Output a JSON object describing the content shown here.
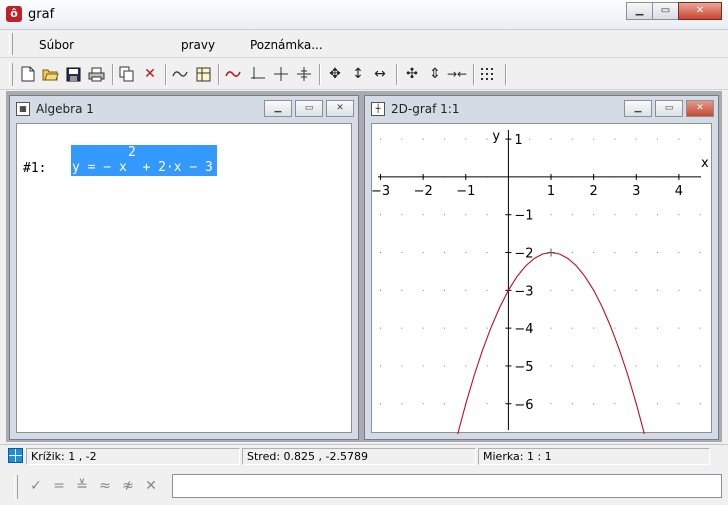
{
  "window": {
    "title": "graf"
  },
  "menu": {
    "items": [
      "Súbor",
      "pravy",
      "Poznámka..."
    ]
  },
  "toolbar": {
    "buttons": [
      "new-file",
      "open-folder",
      "save",
      "print",
      "copy",
      "delete",
      "function",
      "abc-table",
      "curve",
      "axis",
      "cross",
      "cross-hash",
      "move-all",
      "move-vertical",
      "move-horizontal",
      "zoom-in-all",
      "zoom-vertical",
      "zoom-horizontal",
      "grid-dots"
    ]
  },
  "algebra_window": {
    "title": "Algebra 1",
    "expression": {
      "label": "#1:",
      "exponent": "2",
      "body": "y = − x  + 2·x − 3"
    }
  },
  "graph_window": {
    "title": "2D-graf 1:1",
    "x_axis_label": "x",
    "y_axis_label": "y",
    "x_ticks": [
      "−3",
      "−2",
      "−1",
      "1",
      "2",
      "3",
      "4"
    ],
    "y_ticks": [
      "1",
      "−1",
      "−2",
      "−3",
      "−4",
      "−5",
      "−6"
    ]
  },
  "chart_data": {
    "type": "line",
    "function": "y = -x^2 + 2x - 3",
    "x": [
      -1.2,
      -1.0,
      -0.8,
      -0.6,
      -0.4,
      -0.2,
      0.0,
      0.2,
      0.4,
      0.6,
      0.8,
      1.0,
      1.2,
      1.4,
      1.6,
      1.8,
      2.0,
      2.2,
      2.4,
      2.6,
      2.8,
      3.0,
      3.2
    ],
    "y": [
      -6.84,
      -6.0,
      -5.24,
      -4.56,
      -3.96,
      -3.44,
      -3.0,
      -2.64,
      -2.36,
      -2.16,
      -2.04,
      -2.0,
      -2.04,
      -2.16,
      -2.36,
      -2.64,
      -3.0,
      -3.44,
      -3.96,
      -4.56,
      -5.24,
      -6.0,
      -6.84
    ],
    "xlim": [
      -3.2,
      4.8
    ],
    "ylim": [
      -6.8,
      1.4
    ],
    "grid": "dots",
    "color": "#c0101a"
  },
  "status": {
    "cursor": "Krížik: 1 , -2",
    "center": "Stred: 0.825 , -2.5789",
    "scale": "Mierka: 1 : 1"
  },
  "input": {
    "value": ""
  }
}
